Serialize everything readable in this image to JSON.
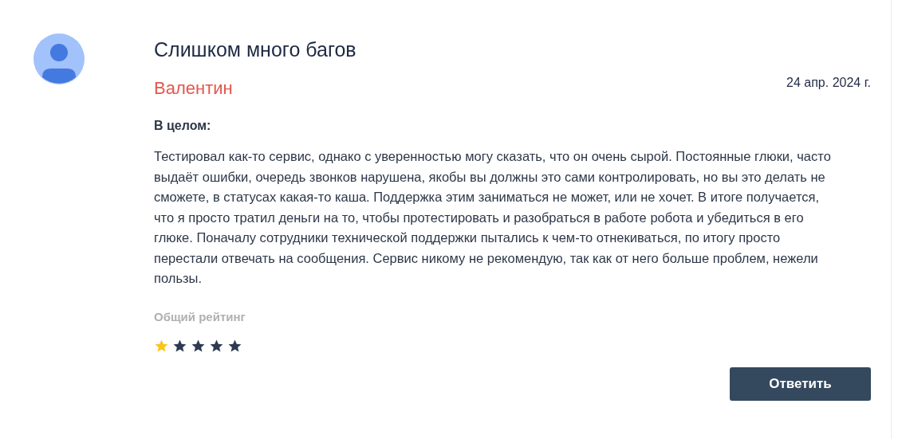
{
  "review": {
    "title": "Слишком много багов",
    "author": "Валентин",
    "date": "24 апр. 2024 г.",
    "section_label": "В целом:",
    "text": "Тестировал как-то сервис, однако с уверенностью могу сказать, что он очень сырой. Постоянные глюки, часто выдаёт ошибки, очередь звонков нарушена, якобы вы должны это сами контролировать, но вы это делать не сможете, в статусах какая-то каша. Поддержка этим заниматься не может, или не хочет. В итоге получается, что я просто тратил деньги на то, чтобы протестировать и разобраться в работе робота и убедиться в его глюке. Поначалу сотрудники технической поддержки пытались к чем-то отнекиваться, по итогу просто перестали отвечать на сообщения. Сервис никому не рекомендую, так как от него больше проблем, нежели пользы.",
    "rating_label": "Общий рейтинг",
    "stars": 1,
    "reply_button": "Ответить"
  }
}
